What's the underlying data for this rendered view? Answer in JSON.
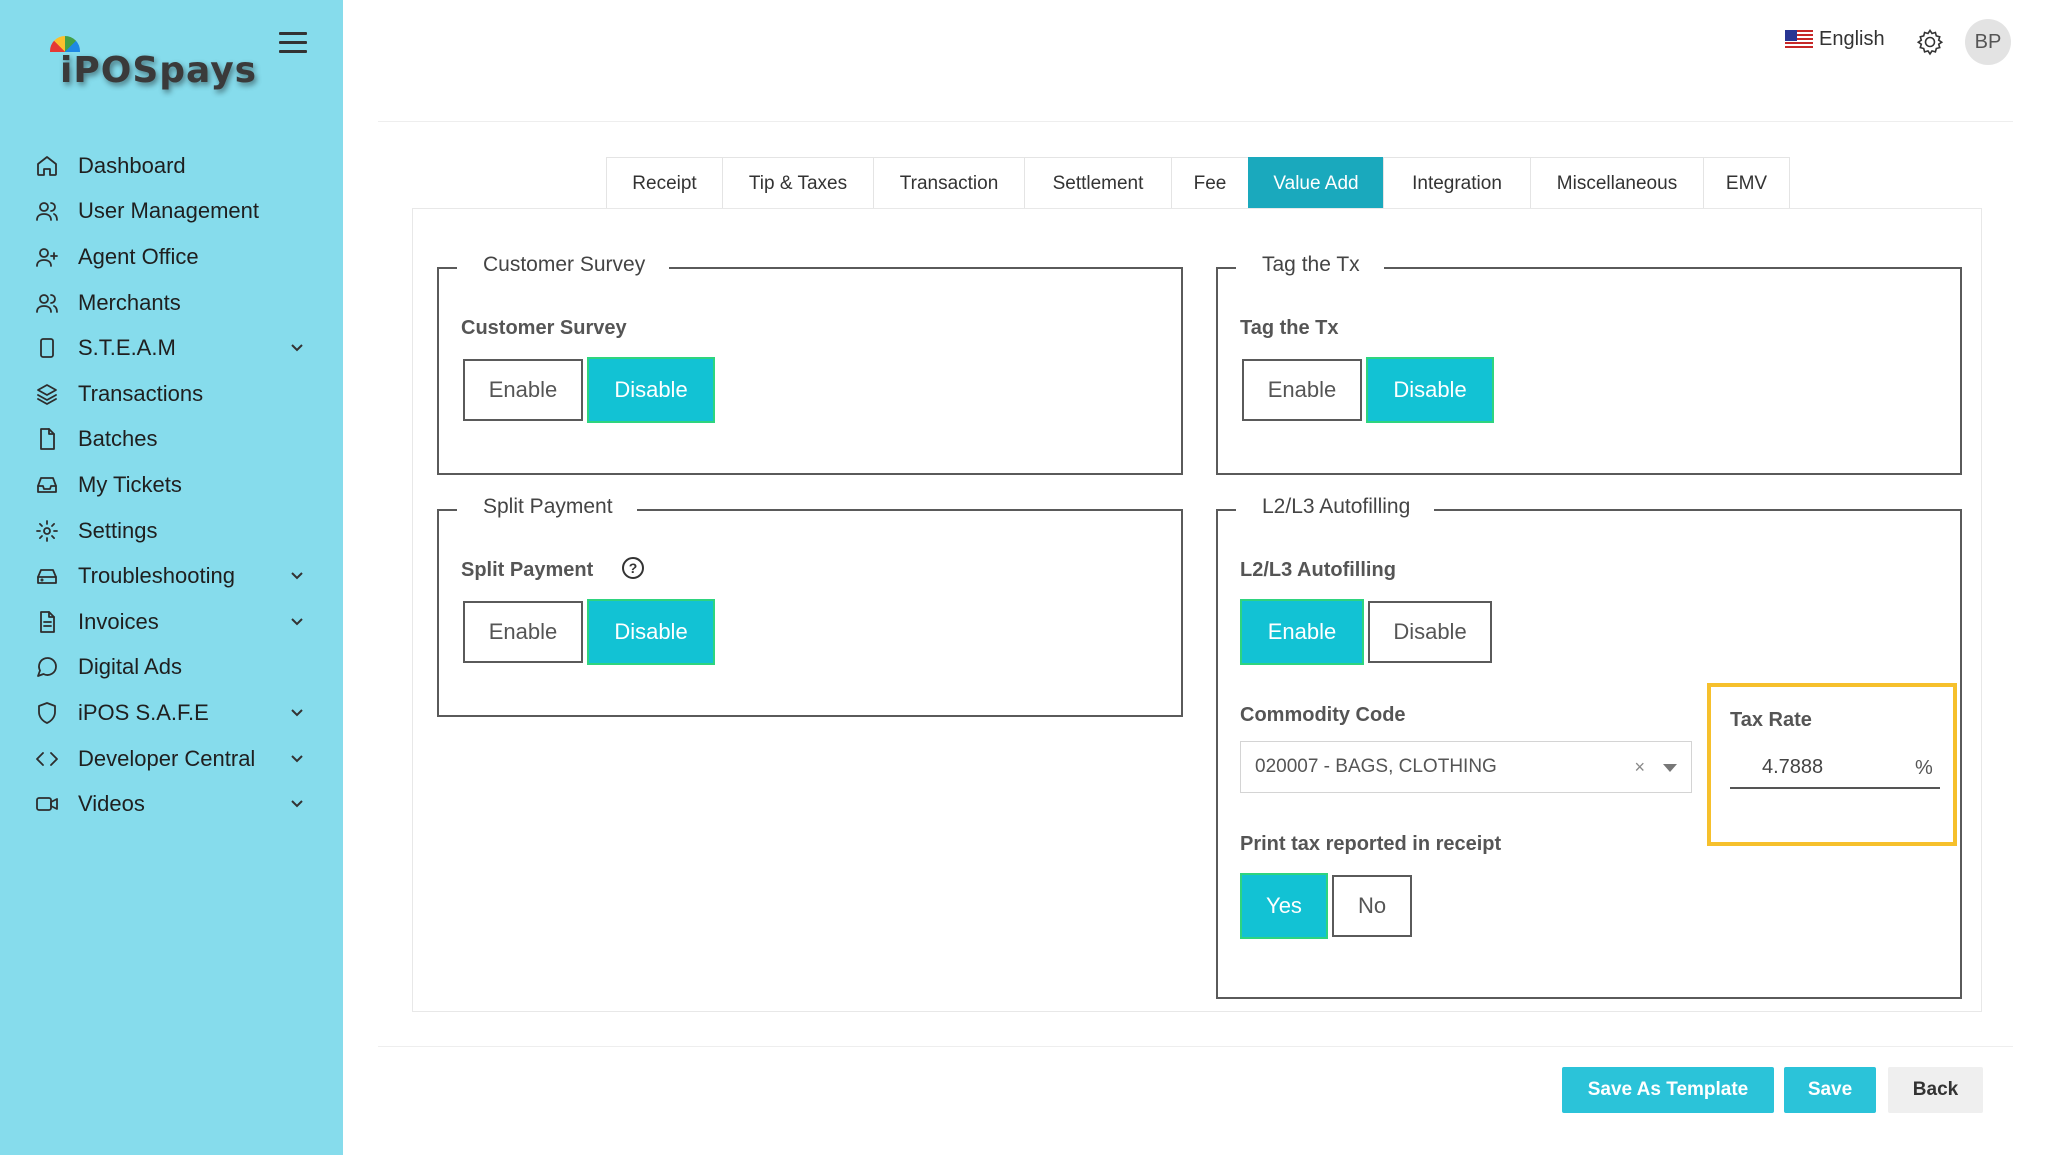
{
  "brand": {
    "logo_text": "iPOSpays"
  },
  "sidebar": {
    "items": [
      {
        "label": "Dashboard",
        "icon": "home-icon",
        "chevron": false
      },
      {
        "label": "User Management",
        "icon": "users-icon",
        "chevron": false
      },
      {
        "label": "Agent Office",
        "icon": "user-plus-icon",
        "chevron": false
      },
      {
        "label": "Merchants",
        "icon": "users-icon",
        "chevron": false
      },
      {
        "label": "S.T.E.A.M",
        "icon": "tablet-icon",
        "chevron": true
      },
      {
        "label": "Transactions",
        "icon": "layers-icon",
        "chevron": false
      },
      {
        "label": "Batches",
        "icon": "file-icon",
        "chevron": false
      },
      {
        "label": "My Tickets",
        "icon": "inbox-icon",
        "chevron": false
      },
      {
        "label": "Settings",
        "icon": "gear-icon",
        "chevron": false
      },
      {
        "label": "Troubleshooting",
        "icon": "hard-drive-icon",
        "chevron": true
      },
      {
        "label": "Invoices",
        "icon": "file-text-icon",
        "chevron": true
      },
      {
        "label": "Digital Ads",
        "icon": "message-circle-icon",
        "chevron": false
      },
      {
        "label": "iPOS S.A.F.E",
        "icon": "shield-icon",
        "chevron": true
      },
      {
        "label": "Developer Central",
        "icon": "code-icon",
        "chevron": true
      },
      {
        "label": "Videos",
        "icon": "video-icon",
        "chevron": true
      }
    ]
  },
  "header": {
    "language": "English",
    "avatar_initials": "BP"
  },
  "tabs": [
    {
      "label": "Receipt",
      "active": false
    },
    {
      "label": "Tip & Taxes",
      "active": false
    },
    {
      "label": "Transaction",
      "active": false
    },
    {
      "label": "Settlement",
      "active": false
    },
    {
      "label": "Fee",
      "active": false
    },
    {
      "label": "Value Add",
      "active": true
    },
    {
      "label": "Integration",
      "active": false
    },
    {
      "label": "Miscellaneous",
      "active": false
    },
    {
      "label": "EMV",
      "active": false
    }
  ],
  "panels": {
    "customer_survey": {
      "legend": "Customer Survey",
      "label": "Customer Survey",
      "enable": "Enable",
      "disable": "Disable",
      "selected": "disable"
    },
    "tag_tx": {
      "legend": "Tag the Tx",
      "label": "Tag the Tx",
      "enable": "Enable",
      "disable": "Disable",
      "selected": "disable"
    },
    "split_payment": {
      "legend": "Split Payment",
      "label": "Split Payment",
      "help": "?",
      "enable": "Enable",
      "disable": "Disable",
      "selected": "disable"
    },
    "l2l3": {
      "legend": "L2/L3 Autofilling",
      "label": "L2/L3 Autofilling",
      "enable": "Enable",
      "disable": "Disable",
      "selected": "enable",
      "commodity_label": "Commodity Code",
      "commodity_value": "020007 - BAGS, CLOTHING",
      "clear_glyph": "×",
      "tax_label": "Tax Rate",
      "tax_value": "4.7888",
      "tax_unit": "%",
      "print_label": "Print tax reported in receipt",
      "yes": "Yes",
      "no": "No",
      "print_selected": "yes"
    }
  },
  "footer": {
    "save_template": "Save As Template",
    "save": "Save",
    "back": "Back"
  },
  "colors": {
    "sidebar_bg": "#86dcec",
    "accent": "#12c2d4",
    "tab_active": "#1aa9bd",
    "highlight": "#f6c02c",
    "button": "#2bc3d9"
  }
}
